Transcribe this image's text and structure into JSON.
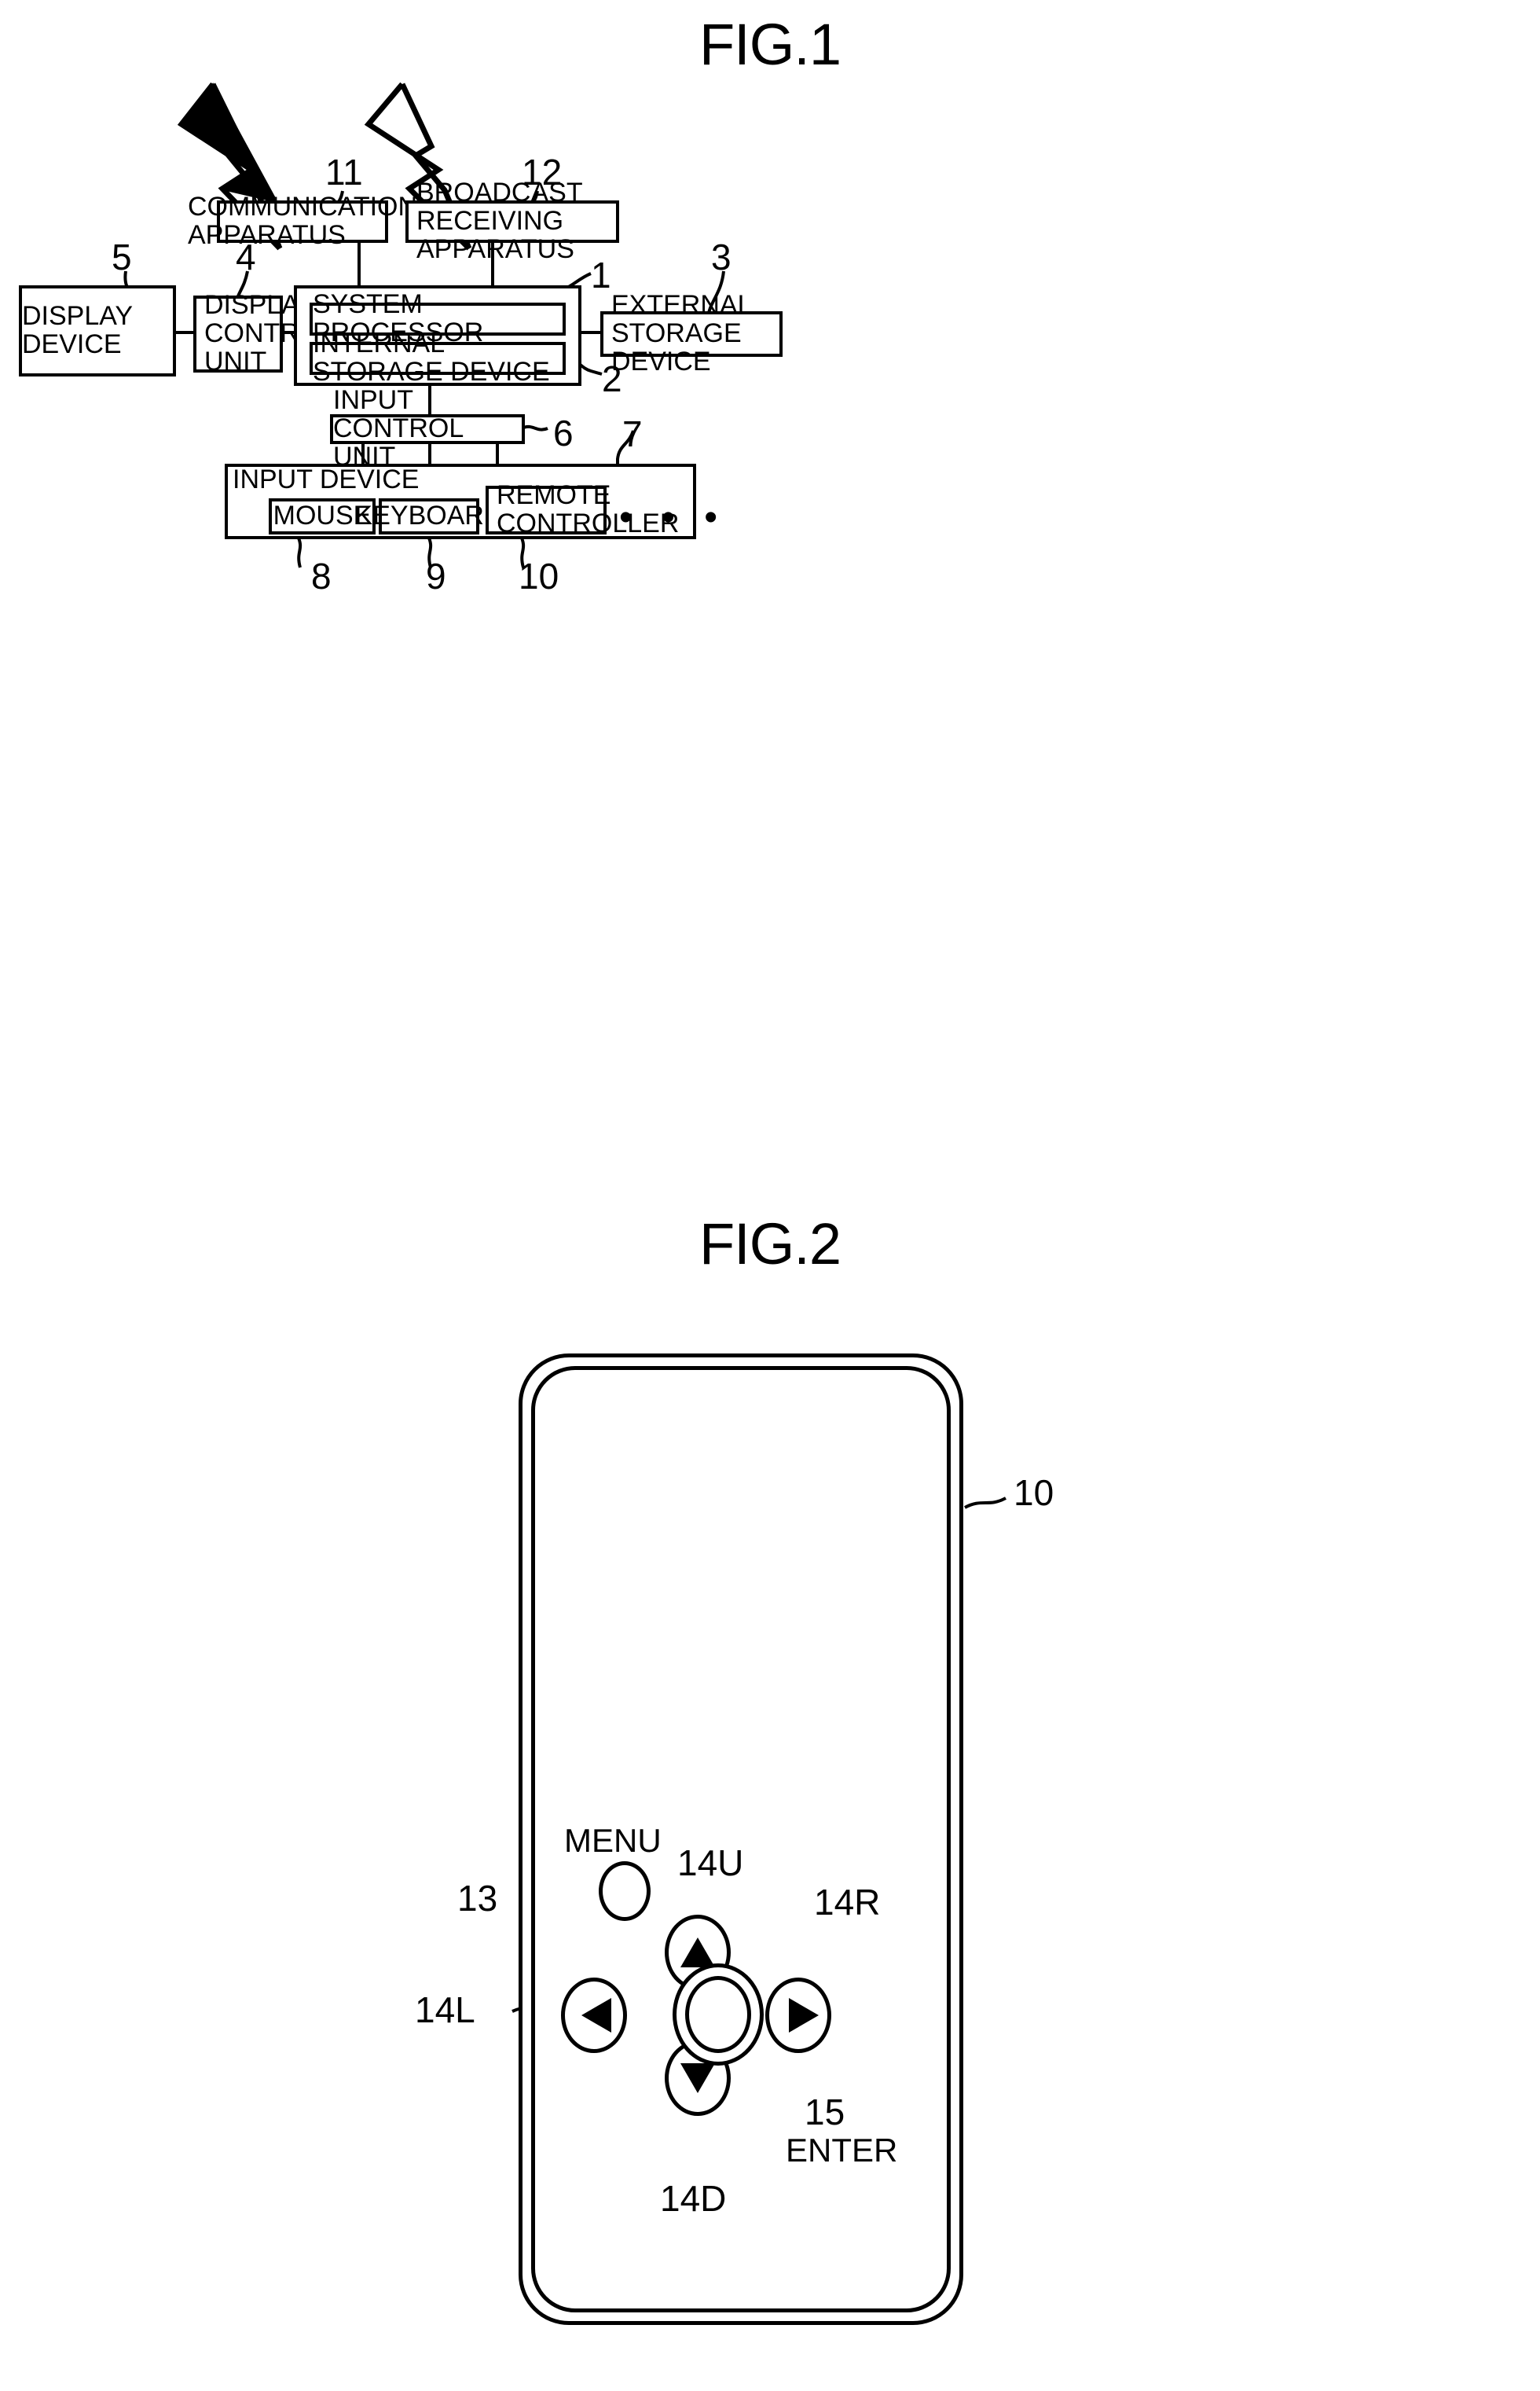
{
  "figures": [
    {
      "id": "fig1",
      "title": "FIG.1"
    },
    {
      "id": "fig2",
      "title": "FIG.2"
    }
  ],
  "fig1": {
    "title": "FIG.1",
    "blocks": {
      "communication_apparatus": "COMMUNICATION\nAPPARATUS",
      "broadcast_receiving_apparatus": "BROADCAST RECEIVING\nAPPARATUS",
      "display_device": "DISPLAY DEVICE",
      "display_control_unit": "DISPLAY\nCONTROL\nUNIT",
      "system_processor": "SYSTEM PROCESSOR",
      "internal_storage_device": "INTERNAL STORAGE DEVICE",
      "external_storage_device": "EXTERNAL STORAGE\nDEVICE",
      "input_control_unit": "INPUT CONTROL UNIT",
      "input_device": "INPUT DEVICE",
      "mouse": "MOUSE",
      "keyboard": "KEYBOARD",
      "remote_controller": "REMOTE\nCONTROLLER",
      "ellipsis": "• • •"
    },
    "reference_numerals": {
      "main_unit": "1",
      "internal_storage_device": "2",
      "external_storage_device": "3",
      "display_control_unit": "4",
      "display_device": "5",
      "input_control_unit": "6",
      "input_device": "7",
      "mouse": "8",
      "keyboard": "9",
      "remote_controller": "10",
      "communication_apparatus": "11",
      "broadcast_receiving_apparatus": "12"
    },
    "symbols": {
      "signal_bolt_left": "lightning-bolt",
      "signal_bolt_right": "lightning-bolt"
    }
  },
  "fig2": {
    "title": "FIG.2",
    "device_label": "remote-controller",
    "buttons": {
      "menu": "MENU",
      "enter": "ENTER"
    },
    "reference_numerals": {
      "remote_controller": "10",
      "menu_button": "13",
      "up_button": "14U",
      "right_button": "14R",
      "left_button": "14L",
      "down_button": "14D",
      "enter_button": "15"
    }
  },
  "style": {
    "ink": "#000000",
    "paper": "#ffffff"
  }
}
